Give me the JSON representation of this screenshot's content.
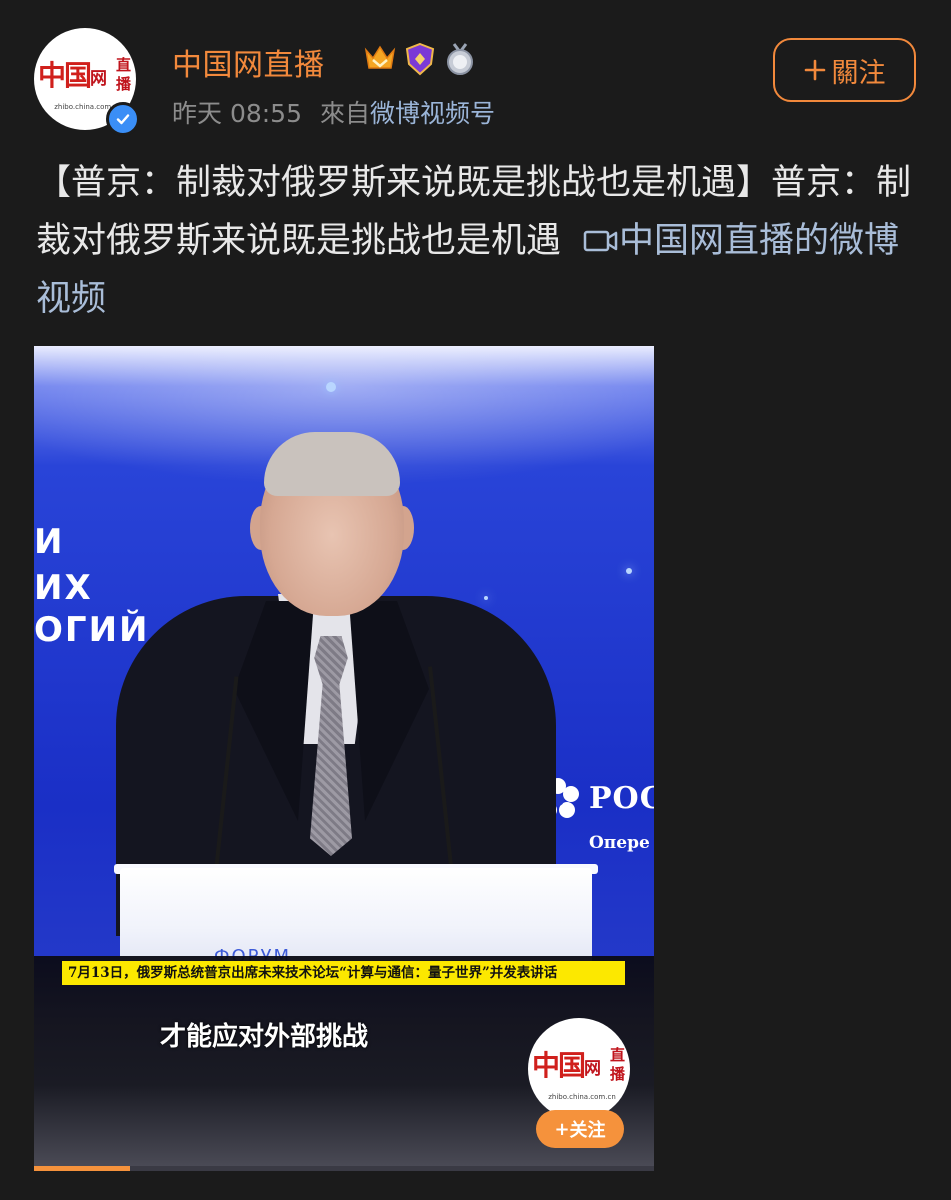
{
  "header": {
    "username": "中国网直播",
    "time": "昨天 08:55",
    "source_prefix": "來自",
    "source": "微博视频号",
    "follow_label": "關注",
    "avatar": {
      "logo_text": "中国",
      "logo_wang": "网",
      "logo_zhibo": "直播",
      "url": "zhibo.china.com.cn"
    },
    "badges": [
      "vip-crown-badge",
      "shield-badge",
      "medal-badge"
    ]
  },
  "post": {
    "text": "【普京：制裁对俄罗斯来说既是挑战也是机遇】普京：制裁对俄罗斯来说既是挑战也是机遇",
    "link": "中国网直播的微博视频"
  },
  "video": {
    "bg_text_1": "И",
    "bg_text_2": "ИХ",
    "bg_text_3": "ОГИЙ",
    "ros_text": "РОС",
    "ros_sub": "Опере",
    "podium_text": "ФОРУМ",
    "caption_bar": "7月13日，俄罗斯总统普京出席未来技术论坛“计算与通信：量子世界”并发表讲话",
    "subtitle": "才能应对外部挑战",
    "watermark": {
      "logo_text": "中国",
      "logo_wang": "网",
      "logo_zhibo": "直播",
      "url": "zhibo.china.com.cn"
    },
    "follow_label": "关注",
    "progress": 0.155
  },
  "colors": {
    "background": "#1b1b1b",
    "accent_orange": "#f2893c",
    "link_blue": "#a9bdd8",
    "caption_yellow": "#fce800",
    "verified_blue": "#3a8ef6"
  }
}
